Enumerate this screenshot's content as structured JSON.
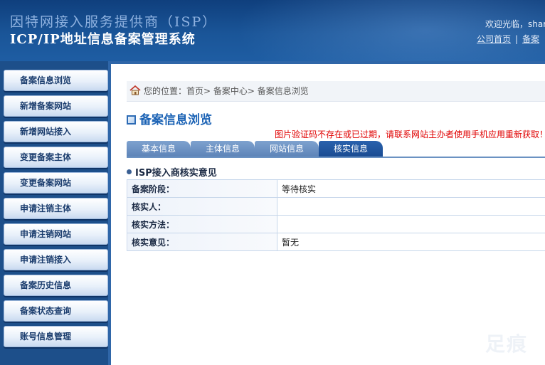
{
  "header": {
    "title_line1": "因特网接入服务提供商（ISP）",
    "title_line2": "ICP/IP地址信息备案管理系统",
    "welcome": "欢迎光临，shar",
    "links": [
      "公司首页",
      "备案"
    ]
  },
  "sidebar": {
    "items": [
      {
        "label": "备案信息浏览"
      },
      {
        "label": "新增备案网站"
      },
      {
        "label": "新增网站接入"
      },
      {
        "label": "变更备案主体"
      },
      {
        "label": "变更备案网站"
      },
      {
        "label": "申请注销主体"
      },
      {
        "label": "申请注销网站"
      },
      {
        "label": "申请注销接入"
      },
      {
        "label": "备案历史信息"
      },
      {
        "label": "备案状态查询"
      },
      {
        "label": "账号信息管理"
      }
    ]
  },
  "breadcrumb": {
    "text": "您的位置：首页> 备案中心> 备案信息浏览"
  },
  "page": {
    "title": "备案信息浏览",
    "error": "图片验证码不存在或已过期，请联系网站主办者使用手机应用重新获取！"
  },
  "tabs": [
    {
      "label": "基本信息",
      "active": false
    },
    {
      "label": "主体信息",
      "active": false
    },
    {
      "label": "网站信息",
      "active": false
    },
    {
      "label": "核实信息",
      "active": true
    }
  ],
  "section": {
    "title": "ISP接入商核实意见",
    "rows": [
      {
        "key": "备案阶段：",
        "value": "等待核实"
      },
      {
        "key": "核实人：",
        "value": ""
      },
      {
        "key": "核实方法：",
        "value": ""
      },
      {
        "key": "核实意见：",
        "value": "暂无"
      }
    ]
  },
  "watermark": "足痕"
}
